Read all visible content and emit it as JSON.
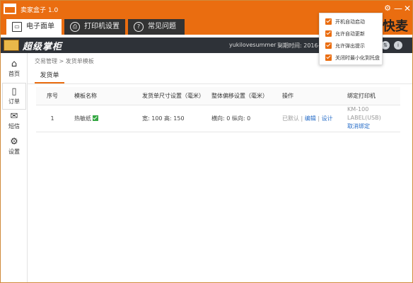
{
  "app": {
    "title": "卖家盒子 1.0",
    "accent_color": "#ea6d10",
    "brand_right": "快麦"
  },
  "title_buttons": {
    "settings_icon": "gear-icon",
    "minimize": "—",
    "close": "✕"
  },
  "top_tabs": [
    {
      "label": "电子面单",
      "icon": "monitor-icon",
      "active": true
    },
    {
      "label": "打印机设置",
      "icon": "printer-icon",
      "active": false
    },
    {
      "label": "常见问题",
      "icon": "question-icon",
      "active": false
    }
  ],
  "inner_header": {
    "logo_text": "超级掌柜",
    "username": "yukilovesummer ⌄",
    "expire_text": "到期时间: 2016-1-2"
  },
  "sidebar": [
    {
      "label": "首页",
      "glyph": "⌂",
      "icon": "home-icon",
      "active": false
    },
    {
      "label": "订单",
      "glyph": "▯",
      "icon": "phone-icon",
      "active": true
    },
    {
      "label": "短信",
      "glyph": "✉",
      "icon": "mail-icon",
      "active": false
    },
    {
      "label": "设置",
      "glyph": "⚙",
      "icon": "gear-icon",
      "active": false
    }
  ],
  "breadcrumb": "交易管理 > 发货单模板",
  "content_tab": "发货单",
  "table": {
    "headers": [
      "序号",
      "模板名称",
      "发货单尺寸设置（毫米）",
      "整体偏移设置（毫米）",
      "操作",
      "绑定打印机"
    ],
    "rows": [
      {
        "index": "1",
        "name": "热敏纸",
        "size": "宽: 100  高: 150",
        "offset": "横向: 0    纵向: 0",
        "op_default": "已默认",
        "op_sep1": " | ",
        "op_edit": "编辑",
        "op_sep2": " | ",
        "op_design": "设计",
        "printer_name": "KM-100 LABEL(USB)",
        "printer_link": "取消绑定"
      }
    ]
  },
  "popup": {
    "items": [
      {
        "label": "开机自动启动",
        "checked": true
      },
      {
        "label": "允许自动更新",
        "checked": true
      },
      {
        "label": "允许弹出提示",
        "checked": true
      },
      {
        "label": "关闭时最小化到托盘",
        "checked": true
      }
    ]
  }
}
